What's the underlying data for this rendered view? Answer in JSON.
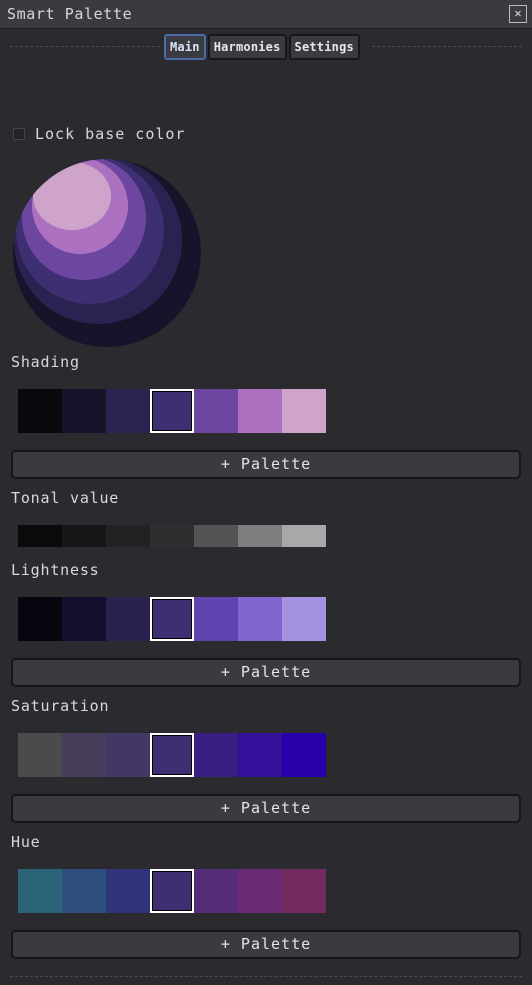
{
  "window": {
    "title": "Smart Palette",
    "close_glyph": "✕"
  },
  "tabs": [
    {
      "label": "Main",
      "active": true
    },
    {
      "label": "Harmonies",
      "active": false
    },
    {
      "label": "Settings",
      "active": false
    }
  ],
  "lock": {
    "label": "Lock base color",
    "checked": false
  },
  "base_color": "#3e2e72",
  "sections": {
    "shading": {
      "label": "Shading",
      "colors": [
        "#09080d",
        "#16132a",
        "#2a2250",
        "#3e2e72",
        "#6d469f",
        "#ac72c0",
        "#cea4cb"
      ],
      "selected": 3,
      "button": "+ Palette"
    },
    "tonal": {
      "label": "Tonal value",
      "colors": [
        "#0b0b0b",
        "#171717",
        "#222222",
        "#2e2e2e",
        "#545454",
        "#7d7d7d",
        "#a8a8a8"
      ]
    },
    "lightness": {
      "label": "Lightness",
      "colors": [
        "#07060f",
        "#150f2f",
        "#2a2150",
        "#3e2e72",
        "#5f43af",
        "#7e66ce",
        "#a592df"
      ],
      "selected": 3,
      "button": "+ Palette"
    },
    "saturation": {
      "label": "Saturation",
      "colors": [
        "#4b4b4c",
        "#483e5c",
        "#433766",
        "#3e2e72",
        "#3a1f82",
        "#33109a",
        "#2a00aa"
      ],
      "selected": 3,
      "button": "+ Palette"
    },
    "hue": {
      "label": "Hue",
      "colors": [
        "#2b6378",
        "#2e4e7e",
        "#2f337a",
        "#3e2e72",
        "#552c78",
        "#6b2a74",
        "#732a61"
      ],
      "selected": 3,
      "button": "+ Palette"
    }
  }
}
